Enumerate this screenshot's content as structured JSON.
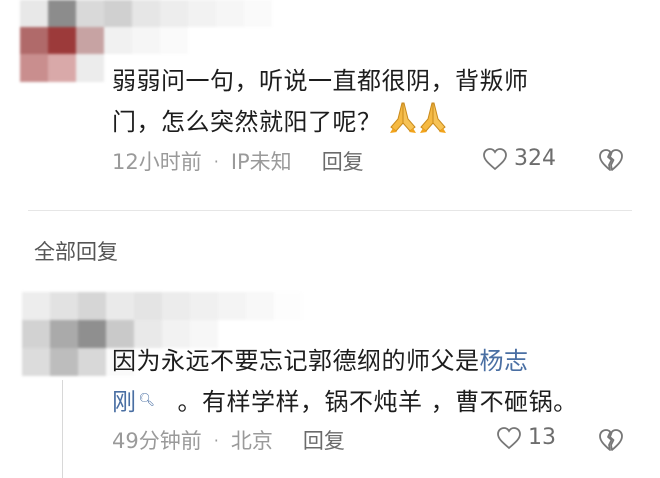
{
  "comments": [
    {
      "text_line1": "弱弱问一句，听说一直都很阴，背叛师",
      "text_line2": "门，怎么突然就阳了呢？",
      "emoji": "praying-hands-icon x2",
      "time": "12小时前",
      "location": "IP未知",
      "reply_label": "回复",
      "likes": "324"
    }
  ],
  "section": {
    "all_replies_label": "全部回复"
  },
  "replies": [
    {
      "text_line1_prefix": "因为永远不要忘记郭德纲的师父是",
      "mention_part1": "杨志",
      "mention_part2": "刚",
      "text_line2_suffix": "。有样学样，锅不炖羊 ，曹不砸锅。",
      "time": "49分钟前",
      "location": "北京",
      "reply_label": "回复",
      "likes": "13"
    }
  ],
  "colors": {
    "mention": "#4a6fa3",
    "meta_gray": "#9a9a9a",
    "divider": "#e6e6e6"
  }
}
